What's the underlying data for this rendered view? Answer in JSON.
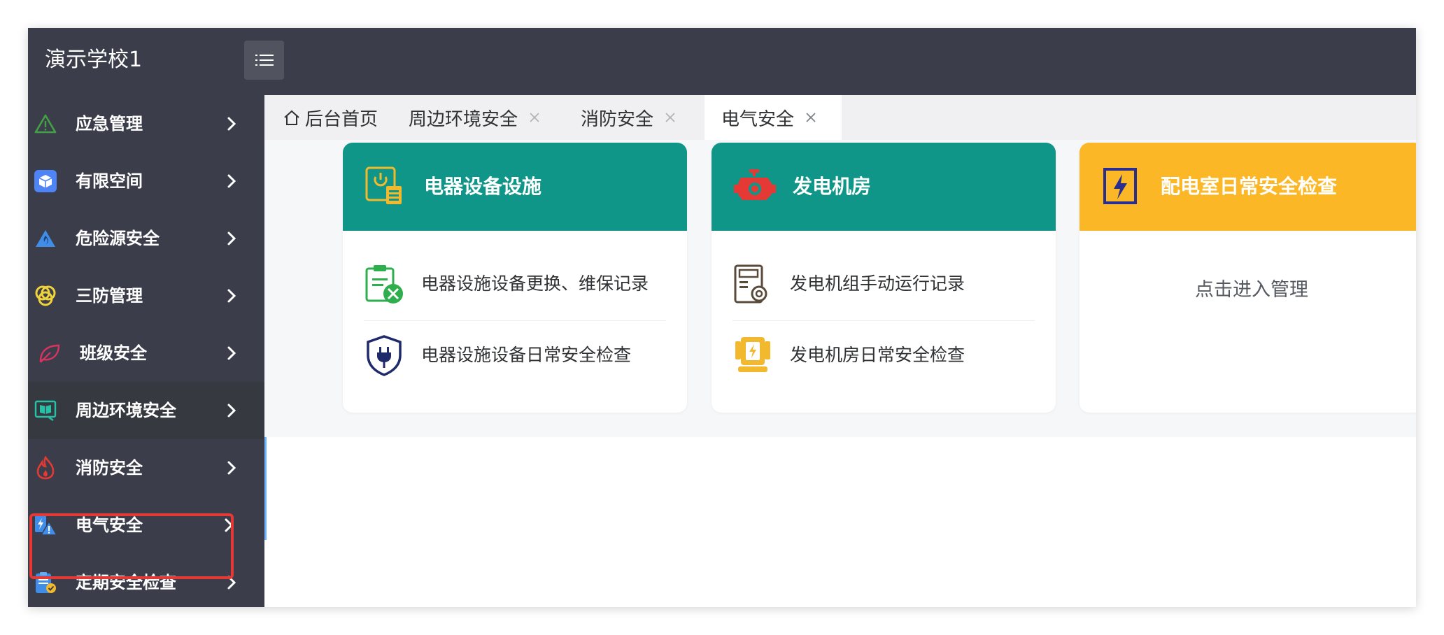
{
  "app": {
    "school_name": "演示学校1"
  },
  "sidebar": {
    "items": [
      {
        "label": "应急管理",
        "icon": "warning-triangle-icon"
      },
      {
        "label": "有限空间",
        "icon": "cube-icon"
      },
      {
        "label": "危险源安全",
        "icon": "hazard-flame-icon"
      },
      {
        "label": "三防管理",
        "icon": "rings-icon"
      },
      {
        "label": "班级安全",
        "icon": "leaf-icon"
      },
      {
        "label": "周边环境安全",
        "icon": "book-monitor-icon"
      },
      {
        "label": "消防安全",
        "icon": "fire-icon"
      },
      {
        "label": "电气安全",
        "icon": "electric-warning-icon"
      },
      {
        "label": "定期安全检查",
        "icon": "clipboard-check-icon"
      }
    ],
    "selected_index": 7
  },
  "tabs": [
    {
      "label": "后台首页",
      "icon": "home-icon",
      "closable": false,
      "active": false
    },
    {
      "label": "周边环境安全",
      "closable": true,
      "active": false
    },
    {
      "label": "消防安全",
      "closable": true,
      "active": false
    },
    {
      "label": "电气安全",
      "closable": true,
      "active": true
    }
  ],
  "cards": [
    {
      "title": "电器设备设施",
      "header_color": "#0f9688",
      "icon": "power-device-icon",
      "rows": [
        {
          "label": "电器设施设备更换、维保记录",
          "icon": "clipboard-tools-icon"
        },
        {
          "label": "电器设施设备日常安全检查",
          "icon": "shield-plug-icon"
        }
      ]
    },
    {
      "title": "发电机房",
      "header_color": "#0f9688",
      "icon": "engine-icon",
      "rows": [
        {
          "label": "发电机组手动运行记录",
          "icon": "machine-gear-icon"
        },
        {
          "label": "发电机房日常安全检查",
          "icon": "generator-icon"
        }
      ]
    },
    {
      "title": "配电室日常安全检查",
      "header_color": "#fbb726",
      "icon": "lightning-box-icon",
      "center_text": "点击进入管理"
    }
  ],
  "colors": {
    "topbar": "#3b3e4a",
    "teal": "#0f9688",
    "amber": "#fbb726",
    "highlight_border": "#e53935"
  }
}
